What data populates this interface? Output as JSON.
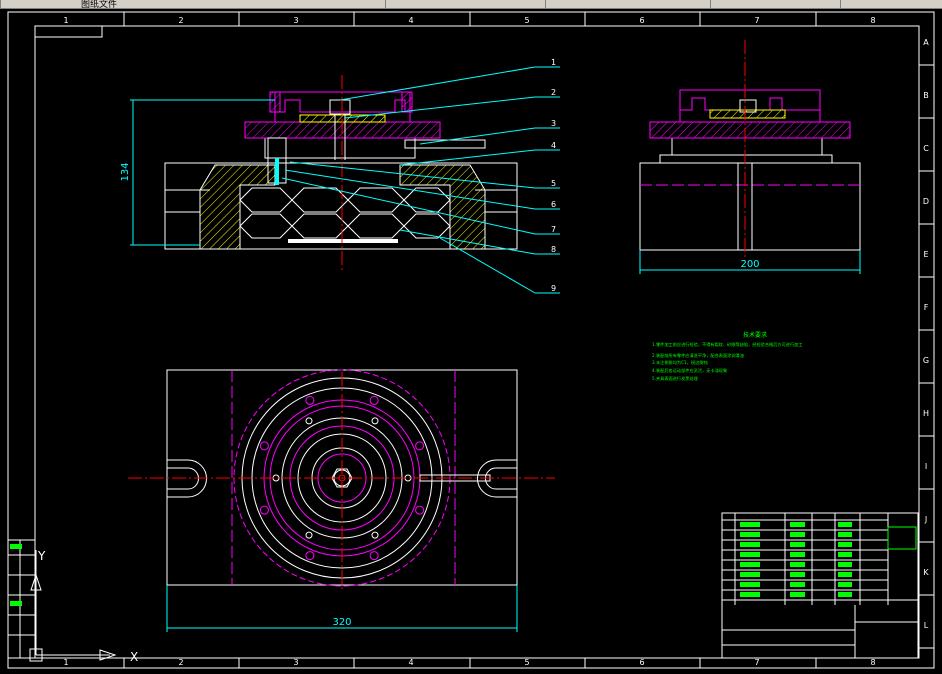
{
  "window": {
    "title": "图纸文件",
    "tabs": [
      "",
      "",
      "",
      "",
      ""
    ]
  },
  "border": {
    "columns": [
      "1",
      "2",
      "3",
      "4",
      "5",
      "6",
      "7",
      "8"
    ],
    "rows": [
      "A",
      "B",
      "C",
      "D",
      "E",
      "F",
      "G",
      "H",
      "I",
      "J",
      "K",
      "L"
    ]
  },
  "dimensions": {
    "height": "134",
    "width_side": "200",
    "width_bottom": "320"
  },
  "callouts": [
    "1",
    "2",
    "3",
    "4",
    "5",
    "6",
    "7",
    "8",
    "9"
  ],
  "tech_notes": {
    "title": "技术要求",
    "lines": [
      "1.零件加工前应进行检验，不得有裂纹、砂眼等缺陷，经检验合格后方可进行加工",
      "2.装配前所有零件应清洗干净，配合表面涂润滑油",
      "3.未注倒角均为C1，锐边倒钝",
      "4.装配后各运动部件应灵活，无卡滞现象",
      "5.夹具表面进行发黑处理"
    ]
  },
  "ucs": {
    "x_label": "X",
    "y_label": "Y"
  },
  "colors": {
    "bg": "#000000",
    "frame": "#ffffff",
    "magenta": "#ff00ff",
    "yellow": "#ffff00",
    "red": "#ff0000",
    "cyan": "#00ffff",
    "green": "#00ff00"
  }
}
